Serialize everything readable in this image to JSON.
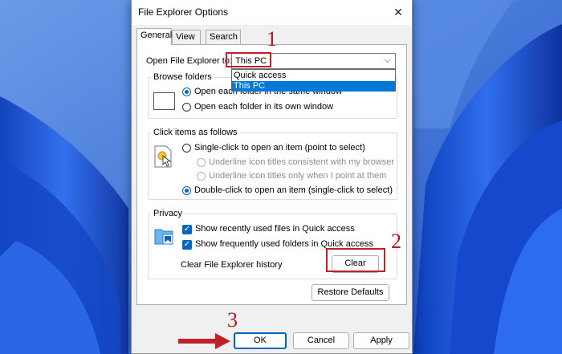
{
  "window": {
    "title": "File Explorer Options",
    "close_glyph": "✕"
  },
  "tabs": [
    {
      "label": "General",
      "active": true
    },
    {
      "label": "View",
      "active": false
    },
    {
      "label": "Search",
      "active": false
    }
  ],
  "open_to": {
    "label": "Open File Explorer to:",
    "value": "This PC",
    "arrow": "⌵",
    "options": [
      "Quick access",
      "This PC"
    ],
    "selected_option": "This PC"
  },
  "browse_folders": {
    "title": "Browse folders",
    "icon": "folder-window-icon",
    "options": [
      {
        "label": "Open each folder in the same window",
        "checked": true
      },
      {
        "label": "Open each folder in its own window",
        "checked": false
      }
    ]
  },
  "click_items": {
    "title": "Click items as follows",
    "icon": "pointer-click-icon",
    "single_click": "Single-click to open an item (point to select)",
    "underline_consistent": "Underline icon titles consistent with my browser",
    "underline_point": "Underline icon titles only when I point at them",
    "double_click": "Double-click to open an item (single-click to select)"
  },
  "privacy": {
    "title": "Privacy",
    "icon": "privacy-folder-icon",
    "recent_files": "Show recently used files in Quick access",
    "frequent_folders": "Show frequently used folders in Quick access",
    "clear_label": "Clear File Explorer history",
    "clear_button": "Clear",
    "check_glyph": "✓"
  },
  "restore_defaults": "Restore Defaults",
  "footer": {
    "ok": "OK",
    "cancel": "Cancel",
    "apply": "Apply"
  },
  "annotations": {
    "step1": "1",
    "step2": "2",
    "step3": "3",
    "color": "#c0202a"
  },
  "colors": {
    "accent": "#0067c0",
    "selection": "#0078d7",
    "wallpaper": "#3a6fd8"
  }
}
